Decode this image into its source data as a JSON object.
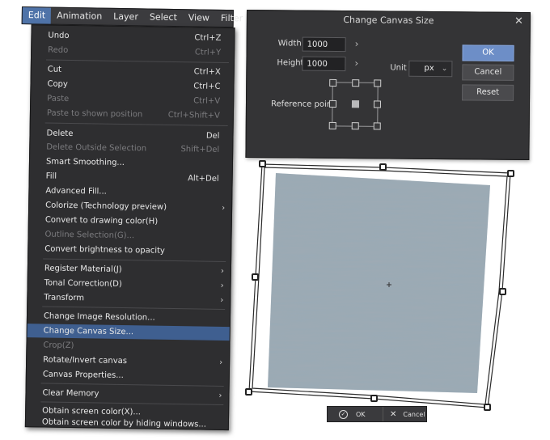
{
  "menubar": {
    "items": [
      "Edit",
      "Animation",
      "Layer",
      "Select",
      "View",
      "Filter"
    ]
  },
  "menu": {
    "items": [
      {
        "label": "Undo",
        "shortcut": "Ctrl+Z"
      },
      {
        "label": "Redo",
        "shortcut": "Ctrl+Y"
      },
      {
        "label": "Cut",
        "shortcut": "Ctrl+X"
      },
      {
        "label": "Copy",
        "shortcut": "Ctrl+C"
      },
      {
        "label": "Paste",
        "shortcut": "Ctrl+V"
      },
      {
        "label": "Paste to shown position",
        "shortcut": "Ctrl+Shift+V"
      },
      {
        "label": "Delete",
        "shortcut": "Del"
      },
      {
        "label": "Delete Outside Selection",
        "shortcut": "Shift+Del"
      },
      {
        "label": "Smart Smoothing...",
        "shortcut": ""
      },
      {
        "label": "Fill",
        "shortcut": "Alt+Del"
      },
      {
        "label": "Advanced Fill...",
        "shortcut": ""
      },
      {
        "label": "Colorize (Technology preview)",
        "shortcut": ""
      },
      {
        "label": "Convert to drawing color(H)",
        "shortcut": ""
      },
      {
        "label": "Outline Selection(G)...",
        "shortcut": ""
      },
      {
        "label": "Convert brightness to opacity",
        "shortcut": ""
      },
      {
        "label": "Register Material(J)",
        "shortcut": ""
      },
      {
        "label": "Tonal Correction(D)",
        "shortcut": ""
      },
      {
        "label": "Transform",
        "shortcut": ""
      },
      {
        "label": "Change Image Resolution...",
        "shortcut": ""
      },
      {
        "label": "Change Canvas Size...",
        "shortcut": ""
      },
      {
        "label": "Crop(Z)",
        "shortcut": ""
      },
      {
        "label": "Rotate/Invert canvas",
        "shortcut": ""
      },
      {
        "label": "Canvas Properties...",
        "shortcut": ""
      },
      {
        "label": "Clear Memory",
        "shortcut": ""
      },
      {
        "label": "Obtain screen color(X)...",
        "shortcut": ""
      },
      {
        "label": "Obtain screen color by hiding windows...",
        "shortcut": ""
      }
    ]
  },
  "dialog": {
    "title": "Change Canvas Size",
    "width_label": "Width:",
    "width_value": "1000",
    "height_label": "Height",
    "height_value": "1000",
    "unit_label": "Unit",
    "unit_value": "px",
    "reference_point_label": "Reference point",
    "ok_label": "OK",
    "cancel_label": "Cancel",
    "reset_label": "Reset"
  },
  "canvas_bar": {
    "ok_label": "OK",
    "cancel_label": "Cancel"
  },
  "colors": {
    "menu_bg": "#2e2e30",
    "highlight": "#3f5f90",
    "primary_button": "#6d8ec7"
  }
}
